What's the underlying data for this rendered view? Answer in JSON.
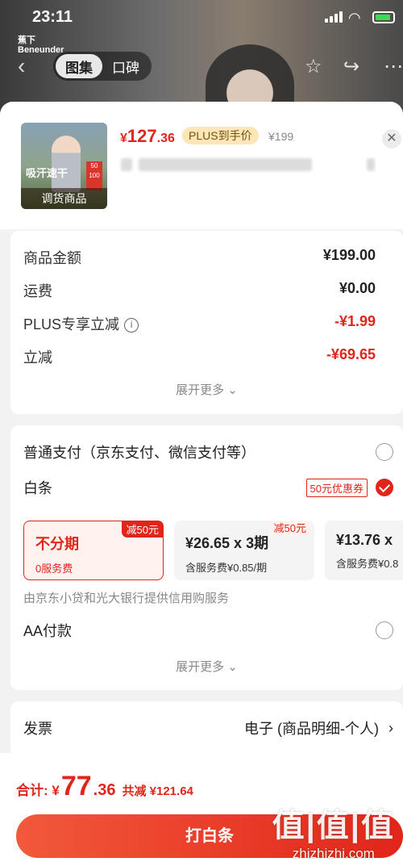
{
  "status": {
    "time": "23:11"
  },
  "header": {
    "brand_line1": "蕉下",
    "brand_line2": "Beneunder",
    "tab_active": "图集",
    "tab_inactive": "口碑"
  },
  "product": {
    "currency": "¥",
    "price_int": "127",
    "price_dec": ".36",
    "plus_tag": "PLUS到手价",
    "original_price": "¥199",
    "thumb_title": "吸汗速干",
    "thumb_badge": "50 100",
    "thumb_tag": "调货商品"
  },
  "summary": {
    "rows": [
      {
        "label": "商品金额",
        "value": "¥199.00"
      },
      {
        "label": "运费",
        "value": "¥0.00"
      },
      {
        "label": "PLUS专享立减",
        "value": "-¥1.99"
      },
      {
        "label": "立减",
        "value": "-¥69.65"
      }
    ],
    "more": "展开更多 ⌄"
  },
  "payment": {
    "normal": "普通支付（京东支付、微信支付等）",
    "baitiao": "白条",
    "coupon": "50元优惠券",
    "options": [
      {
        "main": "不分期",
        "sub": "0服务费",
        "badge": "减50元"
      },
      {
        "main": "¥26.65 x 3期",
        "sub": "含服务费¥0.85/期",
        "badge": "减50元"
      },
      {
        "main": "¥13.76 x",
        "sub": "含服务费¥0.8"
      }
    ],
    "note": "由京东小贷和光大银行提供信用购服务",
    "aa": "AA付款",
    "more": "展开更多 ⌄"
  },
  "invoice": {
    "label": "发票",
    "value": "电子 (商品明细-个人)"
  },
  "footer": {
    "total_label": "合计: ¥",
    "total_int": "77",
    "total_dec": ".36",
    "save": "共减 ¥121.64",
    "cta": "打白条"
  },
  "watermark": {
    "big": "值|值|值",
    "small": "zhizhizhi.com"
  }
}
